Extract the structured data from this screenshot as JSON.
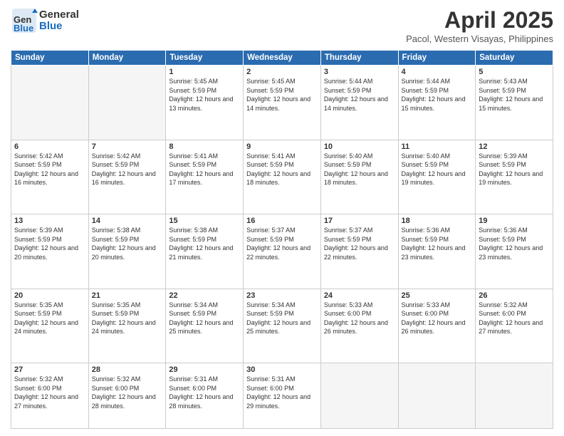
{
  "header": {
    "logo_general": "General",
    "logo_blue": "Blue",
    "month": "April 2025",
    "location": "Pacol, Western Visayas, Philippines"
  },
  "weekdays": [
    "Sunday",
    "Monday",
    "Tuesday",
    "Wednesday",
    "Thursday",
    "Friday",
    "Saturday"
  ],
  "weeks": [
    [
      {
        "day": "",
        "sunrise": "",
        "sunset": "",
        "daylight": "",
        "empty": true
      },
      {
        "day": "",
        "sunrise": "",
        "sunset": "",
        "daylight": "",
        "empty": true
      },
      {
        "day": "1",
        "sunrise": "Sunrise: 5:45 AM",
        "sunset": "Sunset: 5:59 PM",
        "daylight": "Daylight: 12 hours and 13 minutes."
      },
      {
        "day": "2",
        "sunrise": "Sunrise: 5:45 AM",
        "sunset": "Sunset: 5:59 PM",
        "daylight": "Daylight: 12 hours and 14 minutes."
      },
      {
        "day": "3",
        "sunrise": "Sunrise: 5:44 AM",
        "sunset": "Sunset: 5:59 PM",
        "daylight": "Daylight: 12 hours and 14 minutes."
      },
      {
        "day": "4",
        "sunrise": "Sunrise: 5:44 AM",
        "sunset": "Sunset: 5:59 PM",
        "daylight": "Daylight: 12 hours and 15 minutes."
      },
      {
        "day": "5",
        "sunrise": "Sunrise: 5:43 AM",
        "sunset": "Sunset: 5:59 PM",
        "daylight": "Daylight: 12 hours and 15 minutes."
      }
    ],
    [
      {
        "day": "6",
        "sunrise": "Sunrise: 5:42 AM",
        "sunset": "Sunset: 5:59 PM",
        "daylight": "Daylight: 12 hours and 16 minutes."
      },
      {
        "day": "7",
        "sunrise": "Sunrise: 5:42 AM",
        "sunset": "Sunset: 5:59 PM",
        "daylight": "Daylight: 12 hours and 16 minutes."
      },
      {
        "day": "8",
        "sunrise": "Sunrise: 5:41 AM",
        "sunset": "Sunset: 5:59 PM",
        "daylight": "Daylight: 12 hours and 17 minutes."
      },
      {
        "day": "9",
        "sunrise": "Sunrise: 5:41 AM",
        "sunset": "Sunset: 5:59 PM",
        "daylight": "Daylight: 12 hours and 18 minutes."
      },
      {
        "day": "10",
        "sunrise": "Sunrise: 5:40 AM",
        "sunset": "Sunset: 5:59 PM",
        "daylight": "Daylight: 12 hours and 18 minutes."
      },
      {
        "day": "11",
        "sunrise": "Sunrise: 5:40 AM",
        "sunset": "Sunset: 5:59 PM",
        "daylight": "Daylight: 12 hours and 19 minutes."
      },
      {
        "day": "12",
        "sunrise": "Sunrise: 5:39 AM",
        "sunset": "Sunset: 5:59 PM",
        "daylight": "Daylight: 12 hours and 19 minutes."
      }
    ],
    [
      {
        "day": "13",
        "sunrise": "Sunrise: 5:39 AM",
        "sunset": "Sunset: 5:59 PM",
        "daylight": "Daylight: 12 hours and 20 minutes."
      },
      {
        "day": "14",
        "sunrise": "Sunrise: 5:38 AM",
        "sunset": "Sunset: 5:59 PM",
        "daylight": "Daylight: 12 hours and 20 minutes."
      },
      {
        "day": "15",
        "sunrise": "Sunrise: 5:38 AM",
        "sunset": "Sunset: 5:59 PM",
        "daylight": "Daylight: 12 hours and 21 minutes."
      },
      {
        "day": "16",
        "sunrise": "Sunrise: 5:37 AM",
        "sunset": "Sunset: 5:59 PM",
        "daylight": "Daylight: 12 hours and 22 minutes."
      },
      {
        "day": "17",
        "sunrise": "Sunrise: 5:37 AM",
        "sunset": "Sunset: 5:59 PM",
        "daylight": "Daylight: 12 hours and 22 minutes."
      },
      {
        "day": "18",
        "sunrise": "Sunrise: 5:36 AM",
        "sunset": "Sunset: 5:59 PM",
        "daylight": "Daylight: 12 hours and 23 minutes."
      },
      {
        "day": "19",
        "sunrise": "Sunrise: 5:36 AM",
        "sunset": "Sunset: 5:59 PM",
        "daylight": "Daylight: 12 hours and 23 minutes."
      }
    ],
    [
      {
        "day": "20",
        "sunrise": "Sunrise: 5:35 AM",
        "sunset": "Sunset: 5:59 PM",
        "daylight": "Daylight: 12 hours and 24 minutes."
      },
      {
        "day": "21",
        "sunrise": "Sunrise: 5:35 AM",
        "sunset": "Sunset: 5:59 PM",
        "daylight": "Daylight: 12 hours and 24 minutes."
      },
      {
        "day": "22",
        "sunrise": "Sunrise: 5:34 AM",
        "sunset": "Sunset: 5:59 PM",
        "daylight": "Daylight: 12 hours and 25 minutes."
      },
      {
        "day": "23",
        "sunrise": "Sunrise: 5:34 AM",
        "sunset": "Sunset: 5:59 PM",
        "daylight": "Daylight: 12 hours and 25 minutes."
      },
      {
        "day": "24",
        "sunrise": "Sunrise: 5:33 AM",
        "sunset": "Sunset: 6:00 PM",
        "daylight": "Daylight: 12 hours and 26 minutes."
      },
      {
        "day": "25",
        "sunrise": "Sunrise: 5:33 AM",
        "sunset": "Sunset: 6:00 PM",
        "daylight": "Daylight: 12 hours and 26 minutes."
      },
      {
        "day": "26",
        "sunrise": "Sunrise: 5:32 AM",
        "sunset": "Sunset: 6:00 PM",
        "daylight": "Daylight: 12 hours and 27 minutes."
      }
    ],
    [
      {
        "day": "27",
        "sunrise": "Sunrise: 5:32 AM",
        "sunset": "Sunset: 6:00 PM",
        "daylight": "Daylight: 12 hours and 27 minutes."
      },
      {
        "day": "28",
        "sunrise": "Sunrise: 5:32 AM",
        "sunset": "Sunset: 6:00 PM",
        "daylight": "Daylight: 12 hours and 28 minutes."
      },
      {
        "day": "29",
        "sunrise": "Sunrise: 5:31 AM",
        "sunset": "Sunset: 6:00 PM",
        "daylight": "Daylight: 12 hours and 28 minutes."
      },
      {
        "day": "30",
        "sunrise": "Sunrise: 5:31 AM",
        "sunset": "Sunset: 6:00 PM",
        "daylight": "Daylight: 12 hours and 29 minutes."
      },
      {
        "day": "",
        "sunrise": "",
        "sunset": "",
        "daylight": "",
        "empty": true
      },
      {
        "day": "",
        "sunrise": "",
        "sunset": "",
        "daylight": "",
        "empty": true
      },
      {
        "day": "",
        "sunrise": "",
        "sunset": "",
        "daylight": "",
        "empty": true
      }
    ]
  ]
}
